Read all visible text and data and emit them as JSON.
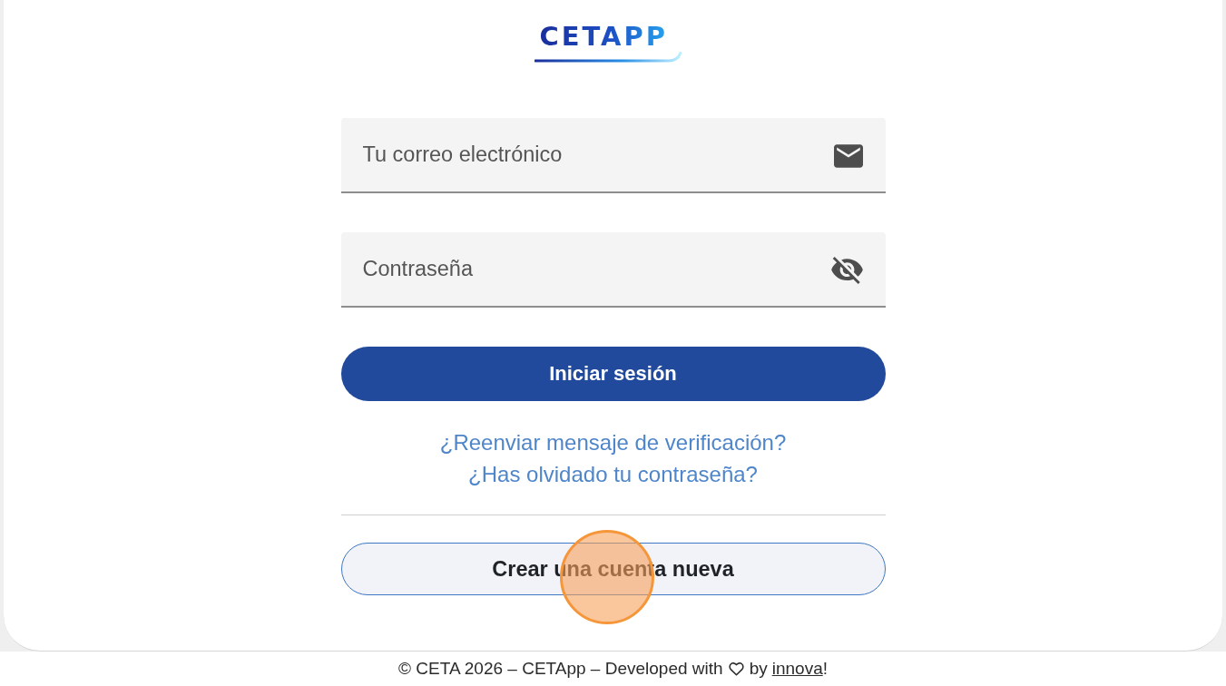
{
  "logo": {
    "text": "CETAPP"
  },
  "form": {
    "fields": [
      {
        "kind": "email",
        "placeholder": "Tu correo electrónico"
      },
      {
        "kind": "password",
        "placeholder": "Contraseña"
      }
    ],
    "submit_button": "Iniciar sesión",
    "links": [
      "¿Reenviar mensaje de verificación?",
      "¿Has olvidado tu contraseña?"
    ],
    "secondary_button": "Crear una cuenta nueva"
  },
  "footer": {
    "text_before": "© CETA 2026 – CETApp – Developed with",
    "text_middle": "by",
    "link": "innova",
    "text_after": "!"
  }
}
